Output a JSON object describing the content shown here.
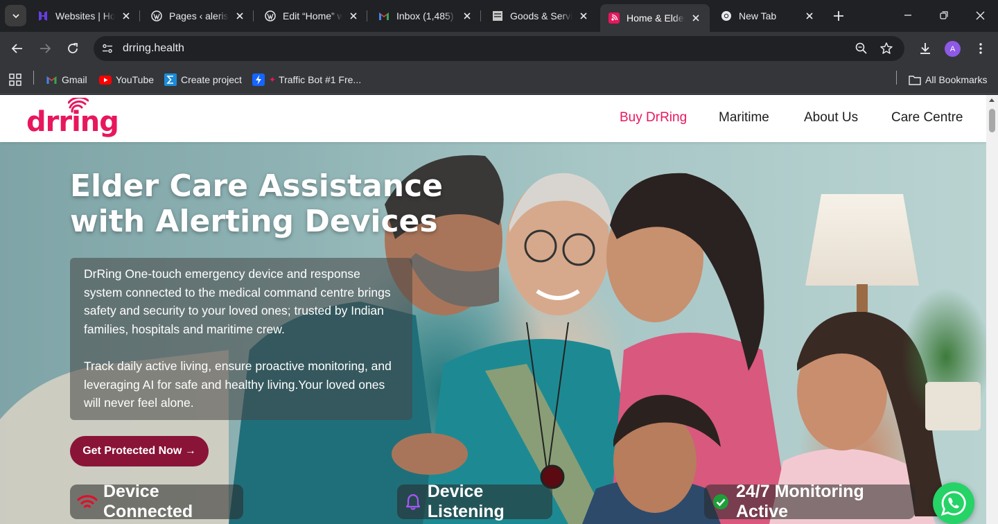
{
  "browser": {
    "tabs": [
      {
        "title": "Websites | Ho",
        "icon": "hostinger-icon",
        "active": false
      },
      {
        "title": "Pages ‹ aleris.v",
        "icon": "wordpress-icon",
        "active": false
      },
      {
        "title": "Edit “Home” w",
        "icon": "wordpress-icon",
        "active": false
      },
      {
        "title": "Inbox (1,485)",
        "icon": "gmail-icon",
        "active": false
      },
      {
        "title": "Goods & Servi",
        "icon": "gov-icon",
        "active": false
      },
      {
        "title": "Home & Elder",
        "icon": "drring-icon",
        "active": true
      },
      {
        "title": "New Tab",
        "icon": "chrome-icon",
        "active": false
      }
    ],
    "url": "drring.health",
    "profile_initial": "A",
    "bookmarks": [
      {
        "label": "Gmail",
        "icon": "gmail-icon"
      },
      {
        "label": "YouTube",
        "icon": "youtube-icon"
      },
      {
        "label": "Create project",
        "icon": "sigma-icon"
      },
      {
        "label": "Traffic Bot #1 Fre...",
        "icon": "bolt-icon"
      }
    ],
    "all_bookmarks": "All Bookmarks"
  },
  "site": {
    "logo_text": "drring",
    "nav": [
      "Buy DrRing",
      "Maritime",
      "About Us",
      "Care Centre"
    ],
    "hero": {
      "title_line1": "Elder Care Assistance",
      "title_line2": "with Alerting Devices",
      "para1": "DrRing One-touch emergency device and response system connected to the medical command centre brings safety and security to your loved ones; trusted by Indian families, hospitals and maritime crew.",
      "para2": "Track daily active living, ensure proactive monitoring, and leveraging AI for safe and healthy living.Your loved ones will never feel alone.",
      "cta": "Get Protected Now →"
    },
    "status": [
      "Device Connected",
      "Device Listening",
      "24/7 Monitoring Active"
    ]
  },
  "colors": {
    "brand": "#e8175d",
    "cta": "#8a1338",
    "whatsapp": "#25d366"
  }
}
